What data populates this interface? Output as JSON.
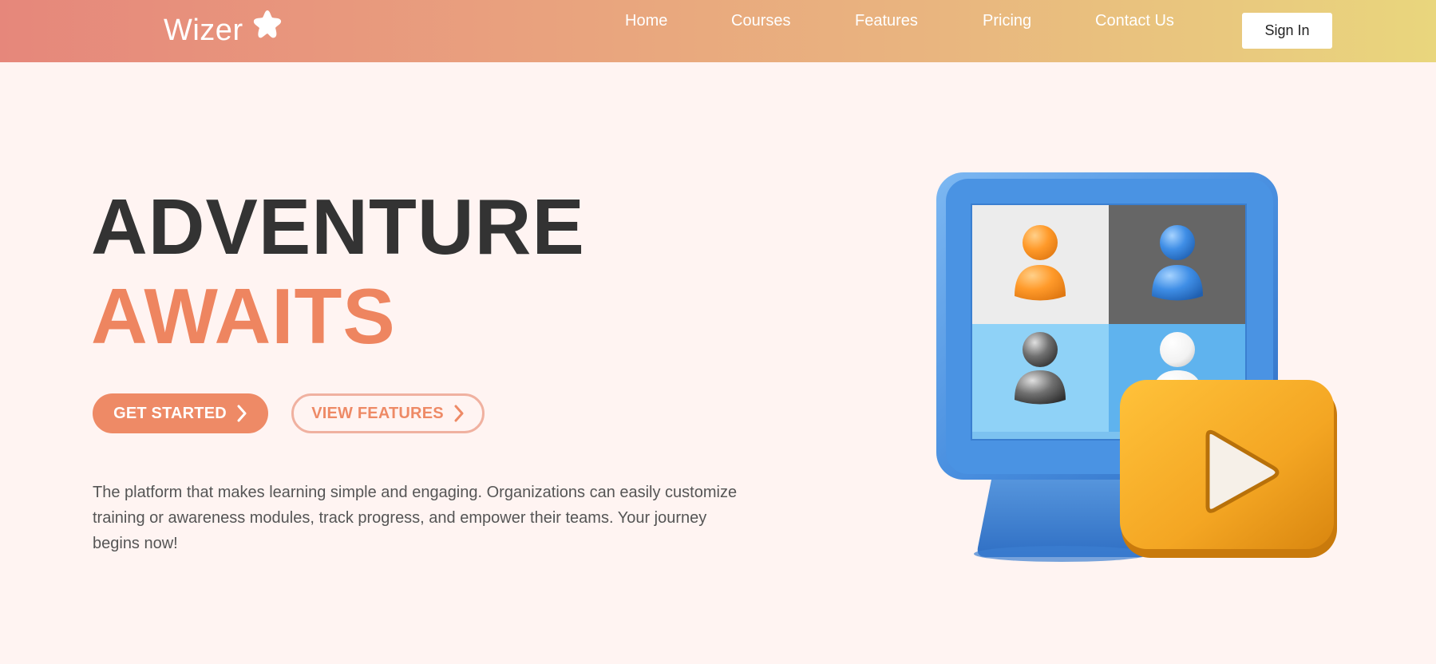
{
  "header": {
    "logo_text": "Wizer",
    "nav": {
      "home": "Home",
      "courses": "Courses",
      "features": "Features",
      "pricing": "Pricing",
      "contact": "Contact Us"
    },
    "sign_in_label": "Sign In"
  },
  "hero": {
    "title_line1": "ADVENTURE",
    "title_line2": "AWAITS",
    "primary_button": "GET STARTED",
    "secondary_button": "VIEW FEATURES",
    "description": "The platform that makes learning simple and engaging. Organizations can easily customize training or awareness modules, track progress, and empower their teams. Your journey begins now!"
  },
  "icons": {
    "logo": "star-icon",
    "button_arrow": "chevron-right-icon",
    "illustration": "video-conference-monitor-illustration"
  },
  "colors": {
    "header_gradient_start": "#e6877b",
    "header_gradient_end": "#e9d67d",
    "accent": "#ee8560",
    "page_background": "#fff4f2",
    "title_dark": "#333333",
    "body_text": "#555555"
  }
}
